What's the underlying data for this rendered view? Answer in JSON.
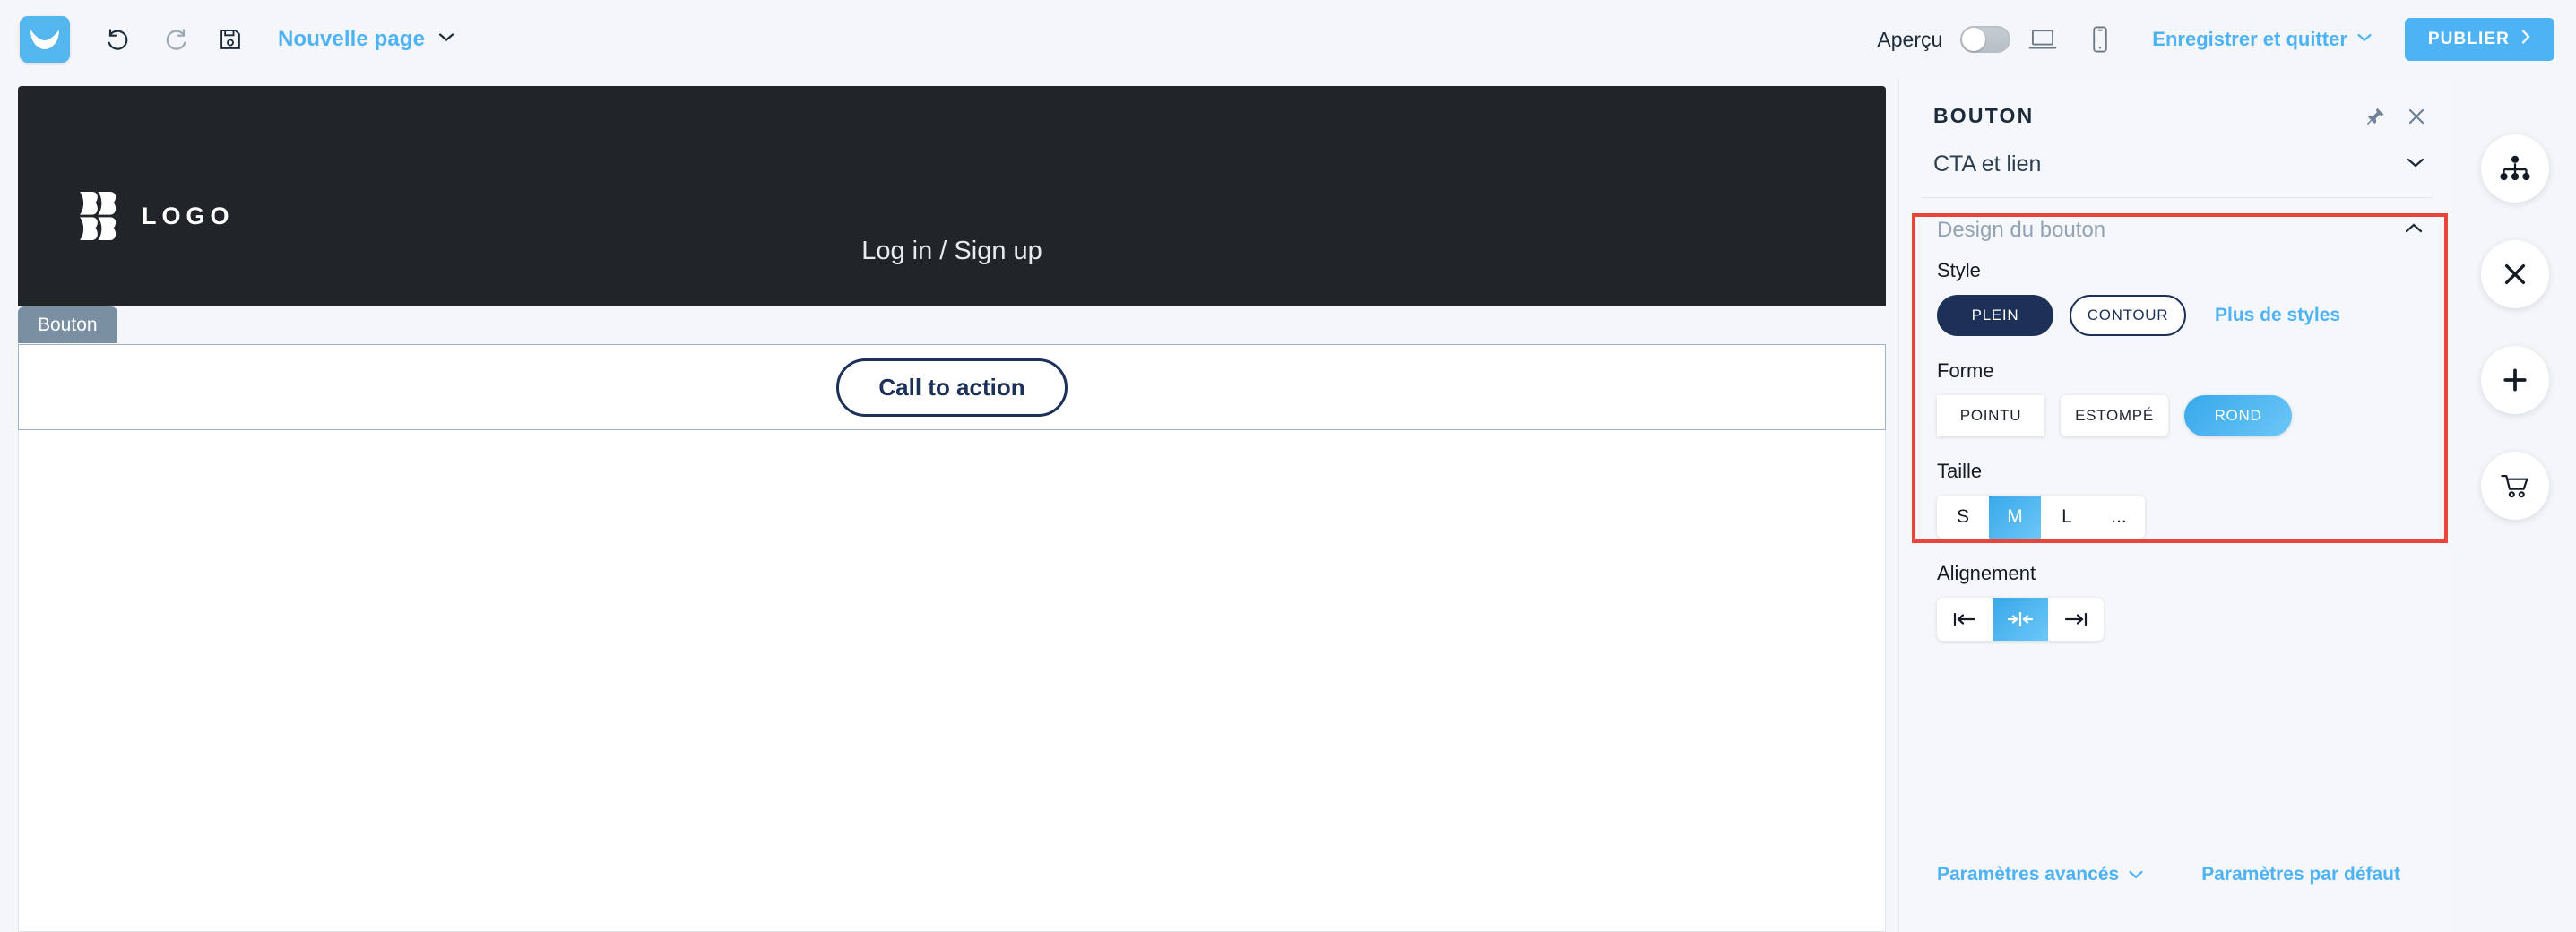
{
  "toolbar": {
    "app_logo_icon": "mailing-app-logo",
    "undo_icon": "undo-icon",
    "redo_icon": "redo-icon",
    "save_icon": "save-floppy-icon",
    "page_name": "Nouvelle page",
    "page_name_chevron_icon": "chevron-down-icon",
    "preview_label": "Aperçu",
    "preview_toggle_state": "off",
    "desktop_icon": "desktop-laptop-icon",
    "mobile_icon": "mobile-phone-icon",
    "save_and_quit": "Enregistrer et quitter",
    "save_and_quit_chevron_icon": "chevron-down-icon",
    "publish_label": "PUBLIER",
    "publish_chevron_icon": "chevron-right-icon",
    "accent_blue": "#4eb3f5"
  },
  "canvas": {
    "site_logo_text": "LOGO",
    "site_logo_icon": "brand-mark-icon",
    "login_link": "Log in / Sign up",
    "block_tab_label": "Bouton",
    "cta_button_label": "Call to action",
    "header_bg": "#212529",
    "cta_border_color": "#1c3058"
  },
  "panel": {
    "title": "BOUTON",
    "pin_icon": "pin-icon",
    "close_icon": "close-icon",
    "accordion": {
      "label": "CTA et lien",
      "chevron_icon": "chevron-down-icon"
    },
    "section": {
      "title": "Design du bouton",
      "chevron_icon": "chevron-up-icon",
      "highlight_color": "#e8453c"
    },
    "style": {
      "label": "Style",
      "options": [
        {
          "label": "PLEIN",
          "selected": true
        },
        {
          "label": "CONTOUR",
          "selected": false
        }
      ],
      "more_link": "Plus de styles"
    },
    "forme": {
      "label": "Forme",
      "options": [
        {
          "label": "POINTU",
          "selected": false
        },
        {
          "label": "ESTOMPÉ",
          "selected": false
        },
        {
          "label": "ROND",
          "selected": true
        }
      ]
    },
    "taille": {
      "label": "Taille",
      "options": [
        {
          "label": "S",
          "selected": false
        },
        {
          "label": "M",
          "selected": true
        },
        {
          "label": "L",
          "selected": false
        },
        {
          "label": "...",
          "selected": false
        }
      ]
    },
    "alignement": {
      "label": "Alignement",
      "options": [
        {
          "icon": "align-left-icon",
          "selected": false
        },
        {
          "icon": "align-center-icon",
          "selected": true
        },
        {
          "icon": "align-right-icon",
          "selected": false
        }
      ]
    },
    "footer": {
      "advanced": "Paramètres avancés",
      "advanced_chevron_icon": "chevron-down-icon",
      "defaults": "Paramètres par défaut"
    }
  },
  "rail": {
    "buttons": [
      {
        "icon": "sitemap-icon"
      },
      {
        "icon": "close-x-icon"
      },
      {
        "icon": "plus-icon"
      },
      {
        "icon": "shopping-cart-icon"
      }
    ]
  }
}
